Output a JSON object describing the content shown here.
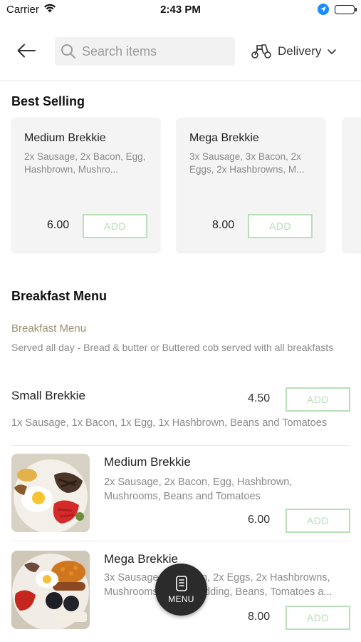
{
  "status_bar": {
    "carrier": "Carrier",
    "time": "2:43 PM"
  },
  "header": {
    "search_placeholder": "Search items",
    "delivery_label": "Delivery"
  },
  "best_selling": {
    "title": "Best Selling",
    "cards": [
      {
        "name": "Medium Brekkie",
        "description": "2x Sausage, 2x Bacon, Egg, Hashbrown, Mushro...",
        "price": "6.00",
        "add_label": "ADD"
      },
      {
        "name": "Mega Brekkie",
        "description": "3x Sausage, 3x Bacon, 2x Eggs, 2x Hashbrowns, M...",
        "price": "8.00",
        "add_label": "ADD"
      }
    ]
  },
  "breakfast_menu": {
    "title": "Breakfast Menu",
    "category_title": "Breakfast Menu",
    "category_description": "Served all day - Bread & butter or Buttered cob served with all breakfasts",
    "items": [
      {
        "name": "Small Brekkie",
        "description": "1x Sausage, 1x Bacon, 1x Egg, 1x Hashbrown, Beans and Tomatoes",
        "price": "4.50",
        "add_label": "ADD"
      },
      {
        "name": "Medium Brekkie",
        "description": "2x Sausage, 2x Bacon, Egg, Hashbrown, Mushrooms, Beans and Tomatoes",
        "price": "6.00",
        "add_label": "ADD"
      },
      {
        "name": "Mega Brekkie",
        "description": "3x Sausage, 3x Bacon, 2x Eggs, 2x Hashbrowns, Mushrooms, Black Pudding, Beans, Tomatoes a...",
        "price": "8.00",
        "add_label": "ADD"
      }
    ]
  },
  "menu_fab": {
    "label": "MENU"
  },
  "colors": {
    "add_border": "#b9dfb9",
    "category_title": "#9a9070",
    "fab_background": "#2b2b2b",
    "location_icon": "#1a8cff"
  },
  "icons": [
    "wifi-icon",
    "location-arrow-icon",
    "battery-icon",
    "back-arrow-icon",
    "search-icon",
    "scooter-icon",
    "chevron-down-icon",
    "menu-card-icon"
  ]
}
